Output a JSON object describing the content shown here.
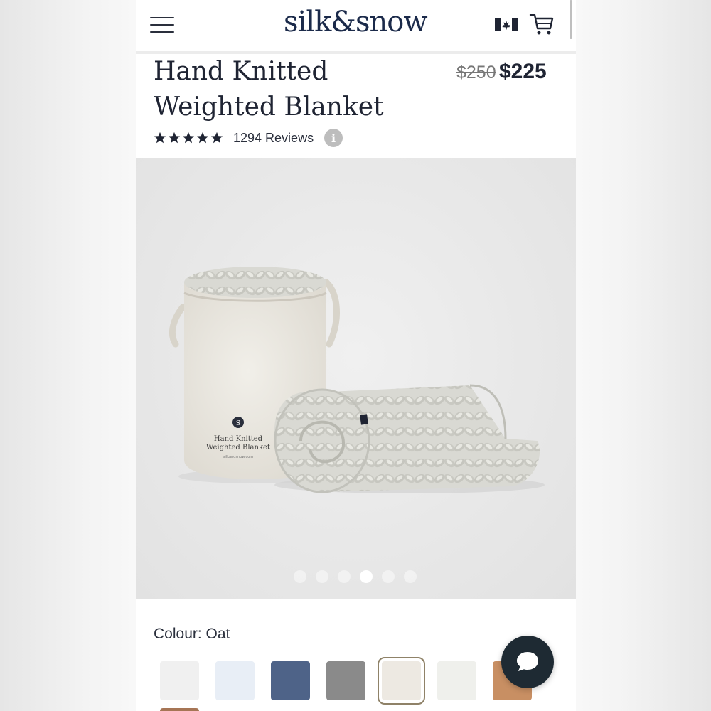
{
  "header": {
    "logo": "silk&snow",
    "menu_icon": "hamburger-menu-icon",
    "flag_icon": "canada-flag-icon",
    "cart_icon": "shopping-cart-icon"
  },
  "product": {
    "title_line1": "Hand Knitted",
    "title_line2": "Weighted Blanket",
    "old_price": "$250",
    "price": "$225",
    "stars": 5,
    "reviews": "1294 Reviews",
    "info_icon": "i"
  },
  "image": {
    "bag_title_line1": "Hand Knitted",
    "bag_title_line2": "Weighted Blanket",
    "bag_url": "silkandsnow.com",
    "bag_monogram": "S",
    "carousel_total": 6,
    "carousel_active": 4
  },
  "colour": {
    "label": "Colour: Oat",
    "swatches": [
      "#f0f0f0",
      "#e8eef6",
      "#4e6388",
      "#8a8a8a",
      "#ede9e2",
      "#eff0ec",
      "#c88f63"
    ],
    "selected_index": 4
  },
  "chat": {
    "icon": "chat-bubble-icon"
  }
}
